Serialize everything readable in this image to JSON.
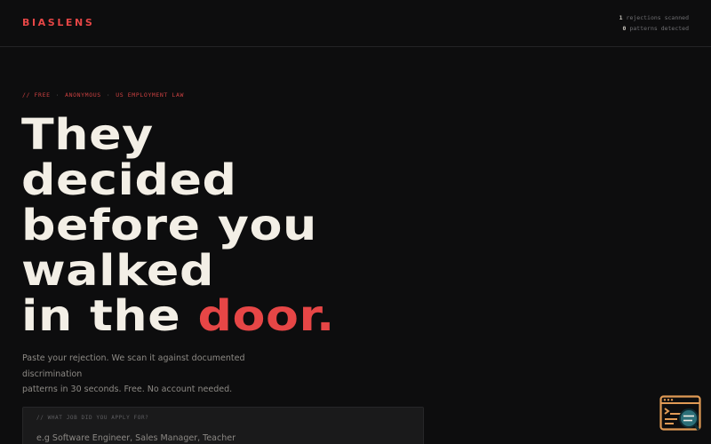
{
  "header": {
    "logo": "BIASLENS",
    "stats": [
      {
        "value": "1",
        "label": "rejections scanned"
      },
      {
        "value": "0",
        "label": "patterns detected"
      }
    ]
  },
  "hero": {
    "eyebrow": {
      "prefix": "// FREE",
      "items": [
        "ANONYMOUS",
        "US EMPLOYMENT LAW"
      ],
      "separator": "·"
    },
    "headline": {
      "line1": "They",
      "line2": "decided",
      "line3": "before you",
      "line4": "walked",
      "line5_prefix": "in the ",
      "line5_accent": "door."
    },
    "subtext_line1": "Paste your rejection. We scan it against documented discrimination",
    "subtext_line2": "patterns in 30 seconds. Free. No account needed."
  },
  "form": {
    "job_label": "// WHAT JOB DID YOU APPLY FOR?",
    "job_placeholder": "e.g Software Engineer, Sales Manager, Teacher",
    "job_value": ""
  },
  "widget": {
    "icon": "terminal-search-icon"
  },
  "colors": {
    "background": "#0d0d0e",
    "accent": "#e64646",
    "text": "#f3efe6",
    "muted": "#8d8a85",
    "widget": "#e09a55"
  }
}
